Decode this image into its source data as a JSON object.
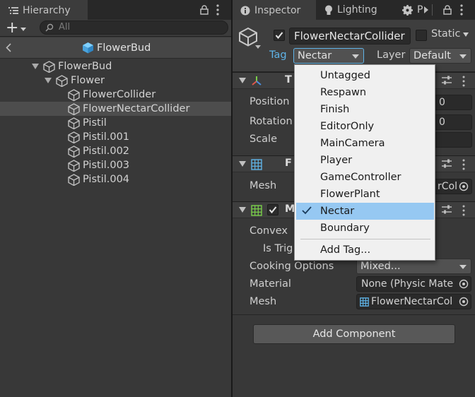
{
  "hierarchy": {
    "tab_label": "Hierarchy",
    "add_label": "+",
    "search_placeholder": "All",
    "scene_title": "FlowerBud",
    "items": [
      {
        "label": "FlowerBud"
      },
      {
        "label": "Flower"
      },
      {
        "label": "FlowerCollider"
      },
      {
        "label": "FlowerNectarCollider"
      },
      {
        "label": "Pistil"
      },
      {
        "label": "Pistil.001"
      },
      {
        "label": "Pistil.002"
      },
      {
        "label": "Pistil.003"
      },
      {
        "label": "Pistil.004"
      }
    ]
  },
  "inspector": {
    "tabs": {
      "inspector": "Inspector",
      "lighting": "Lighting",
      "third": "P"
    },
    "object_name": "FlowerNectarCollider",
    "static_label": "Static",
    "tag_label": "Tag",
    "tag_value": "Nectar",
    "layer_label": "Layer",
    "layer_value": "Default",
    "transform": {
      "title": "T",
      "position_label": "Position",
      "position_value_fragment": "0",
      "rotation_label": "Rotation",
      "rotation_value_fragment": "0",
      "scale_label": "Scale"
    },
    "mesh_filter": {
      "title": "F",
      "mesh_label": "Mesh",
      "mesh_value_fragment": "rCol"
    },
    "mesh_collider": {
      "title": "M",
      "convex_label": "Convex",
      "is_trigger_label": "Is Trig",
      "cooking_label": "Cooking Options",
      "cooking_value": "Mixed...",
      "material_label": "Material",
      "material_value": "None (Physic Mate",
      "mesh_label": "Mesh",
      "mesh_value": "FlowerNectarCol"
    },
    "add_component": "Add Component"
  },
  "tag_menu": {
    "options": [
      "Untagged",
      "Respawn",
      "Finish",
      "EditorOnly",
      "MainCamera",
      "Player",
      "GameController",
      "FlowerPlant",
      "Nectar",
      "Boundary"
    ],
    "selected": "Nectar",
    "add_tag": "Add Tag..."
  },
  "colors": {
    "panel": "#383838",
    "selection": "#96c8f2",
    "accent_blue": "#5fb4e8"
  }
}
